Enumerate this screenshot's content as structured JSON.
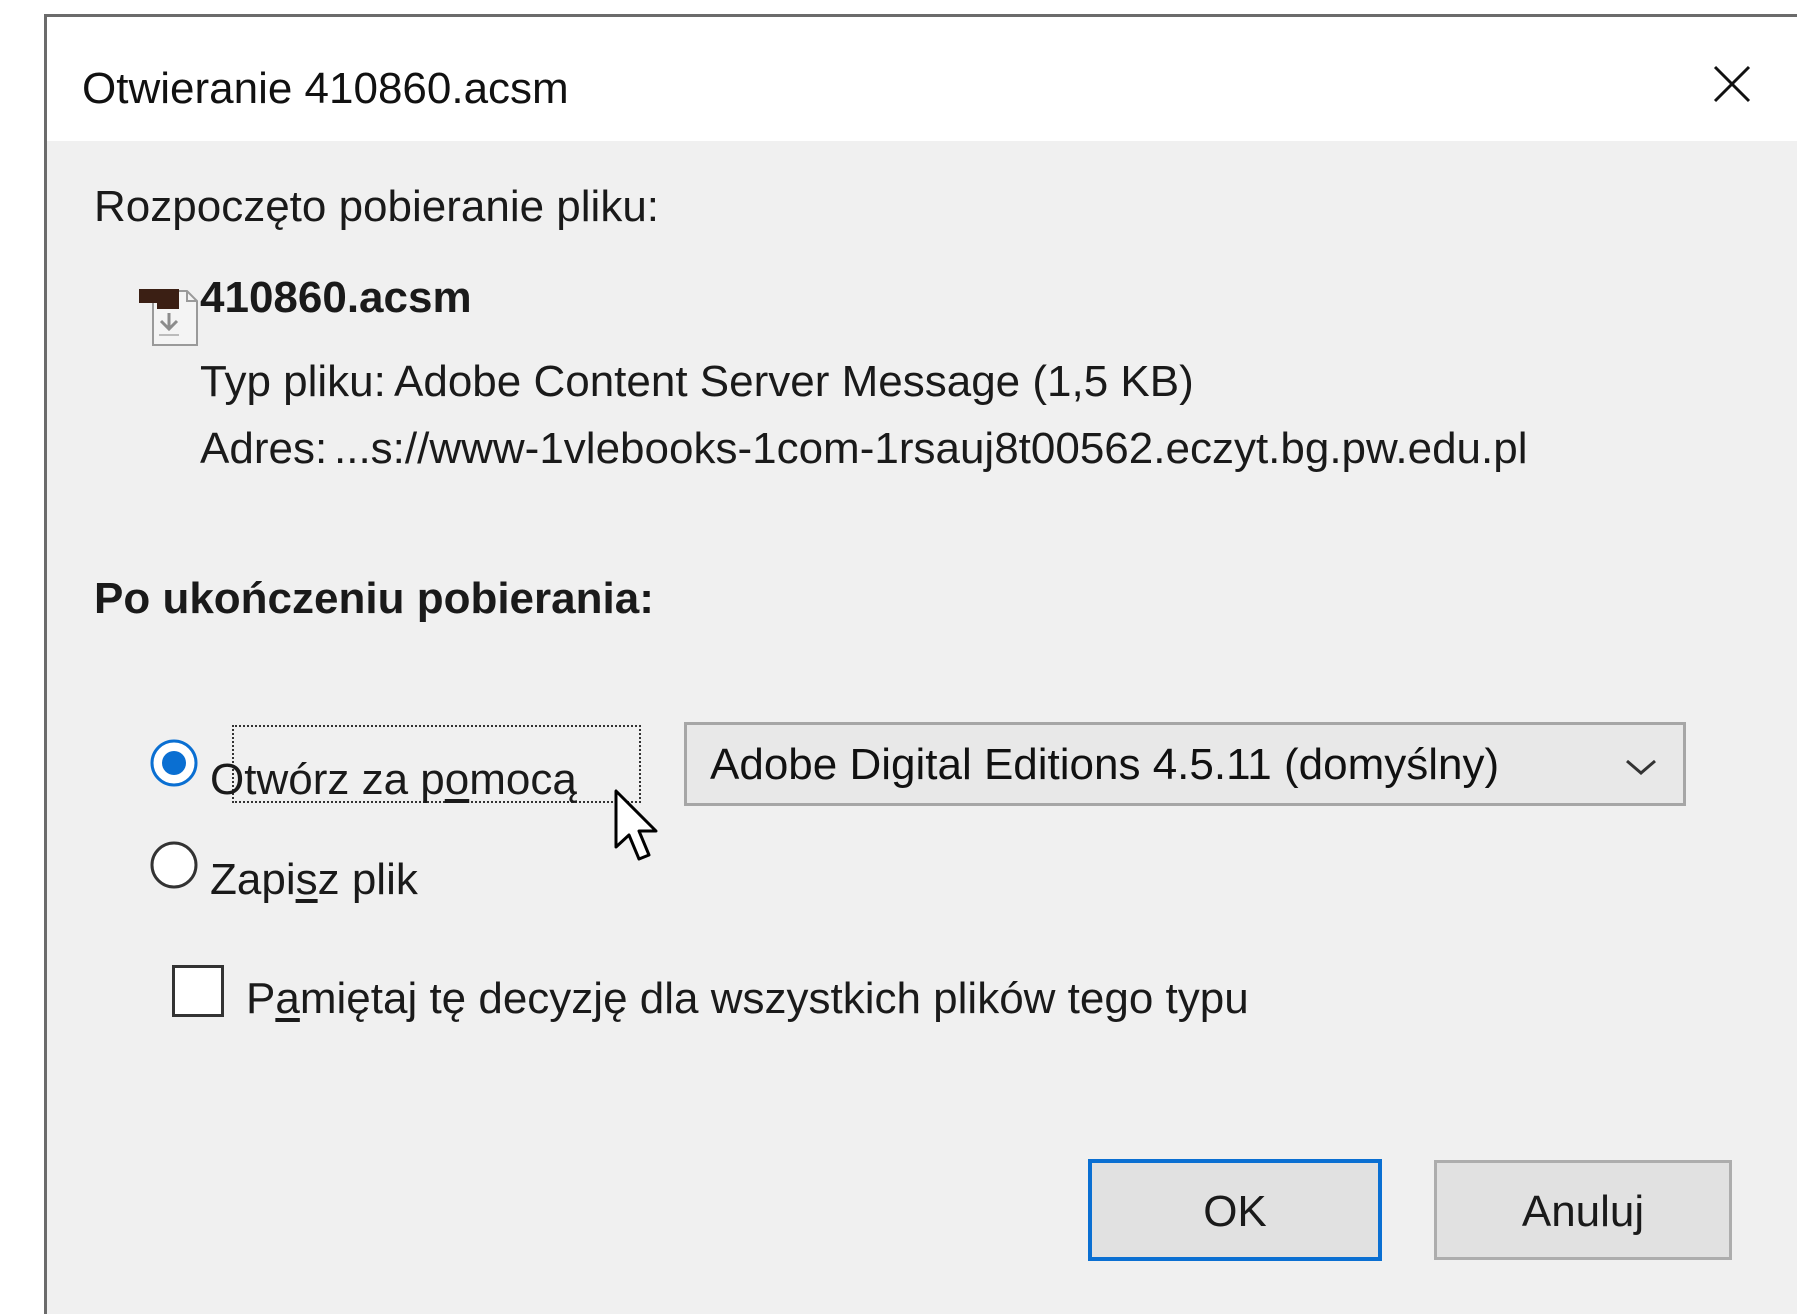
{
  "dialog": {
    "title": "Otwieranie 410860.acsm",
    "close_icon": "close-icon"
  },
  "download": {
    "started_label": "Rozpoczęto pobieranie pliku:",
    "file_icon": "download-file-icon",
    "file_name": "410860.acsm",
    "type_label": "Typ pliku:",
    "type_value": "Adobe Content Server Message (1,5 KB)",
    "address_label": "Adres:",
    "address_value": "...s://www-1vlebooks-1com-1rsauj8t00562.eczyt.bg.pw.edu.pl"
  },
  "after_download": {
    "heading": "Po ukończeniu pobierania:",
    "open_with_prefix": "Otwórz za p",
    "open_with_accel": "o",
    "open_with_suffix": "mocą",
    "open_with_selected": true,
    "app_select_value": "Adobe Digital Editions 4.5.11 (domyślny)",
    "save_prefix": "Zapi",
    "save_accel": "s",
    "save_suffix": "z plik",
    "save_selected": false,
    "remember_prefix": "P",
    "remember_accel": "a",
    "remember_suffix": "miętaj tę decyzję dla wszystkich plików tego typu",
    "remember_checked": false
  },
  "buttons": {
    "ok_label": "OK",
    "cancel_label": "Anuluj"
  },
  "colors": {
    "accent": "#0a6fd2",
    "dialog_bg": "#f0f0f0",
    "titlebar_bg": "#ffffff"
  }
}
